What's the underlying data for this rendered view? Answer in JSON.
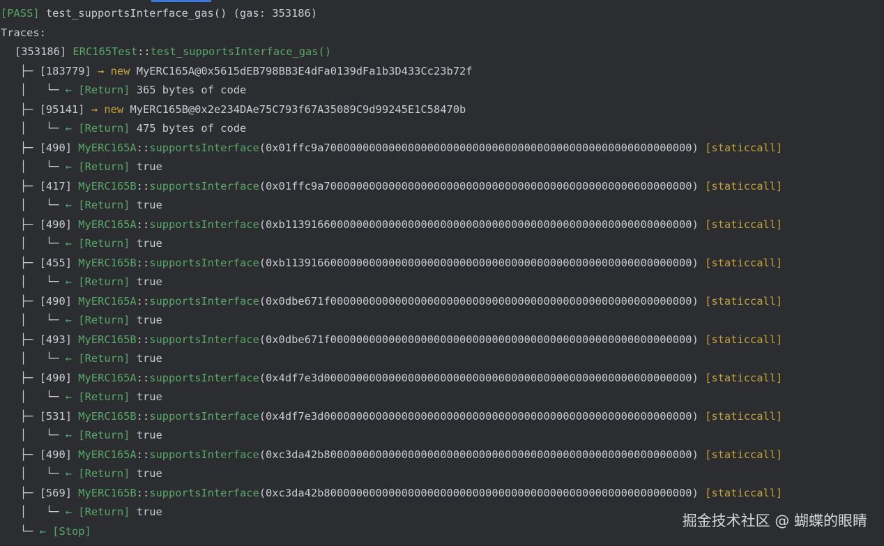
{
  "header": {
    "status": "[PASS]",
    "test_call": "test_supportsInterface_gas()",
    "gas": "(gas: 353186)"
  },
  "traces_label": "Traces:",
  "root": {
    "gas": "[353186]",
    "contract": "ERC165Test",
    "sep": "::",
    "function": "test_supportsInterface_gas()"
  },
  "creates": [
    {
      "gas": "[183779]",
      "arrow": "→",
      "kw": "new",
      "target": "MyERC165A@0x5615dEB798BB3E4dFa0139dFa1b3D433Cc23b72f",
      "ret_arrow": "←",
      "ret_label": "[Return]",
      "ret_value": "365 bytes of code"
    },
    {
      "gas": "[95141]",
      "arrow": "→",
      "kw": "new",
      "target": "MyERC165B@0x2e234DAe75C793f67A35089C9d99245E1C58470b",
      "ret_arrow": "←",
      "ret_label": "[Return]",
      "ret_value": "475 bytes of code"
    }
  ],
  "calls": [
    {
      "gas": "[490]",
      "contract": "MyERC165A",
      "sep": "::",
      "fn": "supportsInterface",
      "args": "(0x01ffc9a700000000000000000000000000000000000000000000000000000000)",
      "tag": "[staticcall]",
      "ret_arrow": "←",
      "ret_label": "[Return]",
      "ret_value": "true"
    },
    {
      "gas": "[417]",
      "contract": "MyERC165B",
      "sep": "::",
      "fn": "supportsInterface",
      "args": "(0x01ffc9a700000000000000000000000000000000000000000000000000000000)",
      "tag": "[staticcall]",
      "ret_arrow": "←",
      "ret_label": "[Return]",
      "ret_value": "true"
    },
    {
      "gas": "[490]",
      "contract": "MyERC165A",
      "sep": "::",
      "fn": "supportsInterface",
      "args": "(0xb113916600000000000000000000000000000000000000000000000000000000)",
      "tag": "[staticcall]",
      "ret_arrow": "←",
      "ret_label": "[Return]",
      "ret_value": "true"
    },
    {
      "gas": "[455]",
      "contract": "MyERC165B",
      "sep": "::",
      "fn": "supportsInterface",
      "args": "(0xb113916600000000000000000000000000000000000000000000000000000000)",
      "tag": "[staticcall]",
      "ret_arrow": "←",
      "ret_label": "[Return]",
      "ret_value": "true"
    },
    {
      "gas": "[490]",
      "contract": "MyERC165A",
      "sep": "::",
      "fn": "supportsInterface",
      "args": "(0x0dbe671f00000000000000000000000000000000000000000000000000000000)",
      "tag": "[staticcall]",
      "ret_arrow": "←",
      "ret_label": "[Return]",
      "ret_value": "true"
    },
    {
      "gas": "[493]",
      "contract": "MyERC165B",
      "sep": "::",
      "fn": "supportsInterface",
      "args": "(0x0dbe671f00000000000000000000000000000000000000000000000000000000)",
      "tag": "[staticcall]",
      "ret_arrow": "←",
      "ret_label": "[Return]",
      "ret_value": "true"
    },
    {
      "gas": "[490]",
      "contract": "MyERC165A",
      "sep": "::",
      "fn": "supportsInterface",
      "args": "(0x4df7e3d000000000000000000000000000000000000000000000000000000000)",
      "tag": "[staticcall]",
      "ret_arrow": "←",
      "ret_label": "[Return]",
      "ret_value": "true"
    },
    {
      "gas": "[531]",
      "contract": "MyERC165B",
      "sep": "::",
      "fn": "supportsInterface",
      "args": "(0x4df7e3d000000000000000000000000000000000000000000000000000000000)",
      "tag": "[staticcall]",
      "ret_arrow": "←",
      "ret_label": "[Return]",
      "ret_value": "true"
    },
    {
      "gas": "[490]",
      "contract": "MyERC165A",
      "sep": "::",
      "fn": "supportsInterface",
      "args": "(0xc3da42b800000000000000000000000000000000000000000000000000000000)",
      "tag": "[staticcall]",
      "ret_arrow": "←",
      "ret_label": "[Return]",
      "ret_value": "true"
    },
    {
      "gas": "[569]",
      "contract": "MyERC165B",
      "sep": "::",
      "fn": "supportsInterface",
      "args": "(0xc3da42b800000000000000000000000000000000000000000000000000000000)",
      "tag": "[staticcall]",
      "ret_arrow": "←",
      "ret_label": "[Return]",
      "ret_value": "true"
    }
  ],
  "stop": {
    "arrow": "←",
    "label": "[Stop]"
  },
  "tree": {
    "branch": "├─",
    "pipe": "│",
    "corner": "└─"
  },
  "watermark": "掘金技术社区 @ 蝴蝶的眼睛",
  "colors": {
    "background": "#2b2d30",
    "green": "#59a869",
    "yellow": "#c6a23c",
    "text": "#c9ccd1",
    "tab_accent": "#3d78d8"
  }
}
